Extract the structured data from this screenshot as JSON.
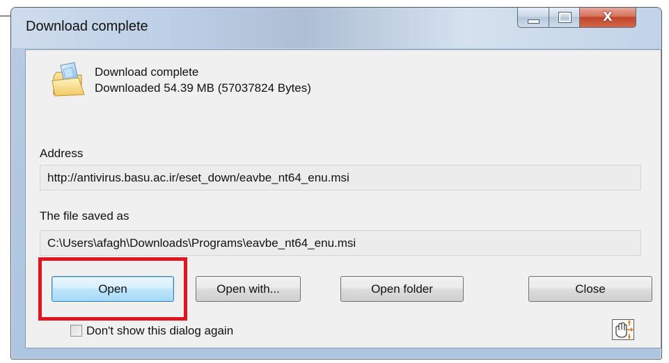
{
  "window": {
    "title": "Download complete",
    "controls": {
      "minimize_icon": "minimize-icon",
      "maximize_icon": "maximize-icon",
      "close_glyph": "X"
    }
  },
  "message": {
    "icon": "folder-icon",
    "line1": "Download complete",
    "line2": "Downloaded 54.39  MB (57037824 Bytes)"
  },
  "address": {
    "label": "Address",
    "value": "http://antivirus.basu.ac.ir/eset_down/eavbe_nt64_enu.msi"
  },
  "saved": {
    "label": "The file saved as",
    "value": "C:\\Users\\afagh\\Downloads\\Programs\\eavbe_nt64_enu.msi"
  },
  "buttons": {
    "open": "Open",
    "open_with": "Open with...",
    "open_folder": "Open folder",
    "close": "Close"
  },
  "options": {
    "dont_show_label": "Don't show this dialog again",
    "dont_show_checked": false
  },
  "colors": {
    "highlight": "#e2141c",
    "default_button": "#bee6fd",
    "close_control": "#c24527"
  }
}
